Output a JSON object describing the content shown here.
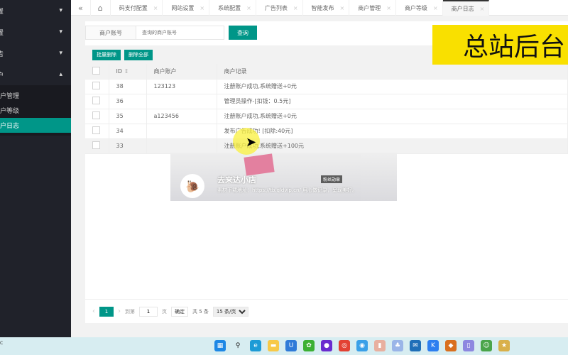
{
  "sidebar": {
    "items": [
      {
        "label": "置"
      },
      {
        "label": "置"
      },
      {
        "label": "告"
      },
      {
        "label": "户"
      }
    ],
    "subitems": [
      {
        "label": "户管理"
      },
      {
        "label": "户等级"
      },
      {
        "label": "户日志",
        "active": true
      }
    ]
  },
  "tabs": [
    {
      "label": "码支付配置"
    },
    {
      "label": "网站设置"
    },
    {
      "label": "系统配置"
    },
    {
      "label": "广告列表"
    },
    {
      "label": "智能发布"
    },
    {
      "label": "商户管理"
    },
    {
      "label": "商户等级"
    },
    {
      "label": "商户日志",
      "active": true
    }
  ],
  "search": {
    "label": "商户账号",
    "placeholder": "查询的商户账号",
    "button": "查询"
  },
  "toolbar": {
    "batch_delete": "批量删除",
    "delete_all": "删除全部"
  },
  "table": {
    "headers": [
      "ID",
      "商户账户",
      "商户记录"
    ],
    "rows": [
      {
        "id": "38",
        "account": "123123",
        "record": "注册账户成功,系统赠送+0元"
      },
      {
        "id": "36",
        "account": "",
        "record": "管理员操作-[扣钱：0.5元]"
      },
      {
        "id": "35",
        "account": "a123456",
        "record": "注册账户成功,系统赠送+0元"
      },
      {
        "id": "34",
        "account": "",
        "record": "发布广告成功! [扣除:40元]"
      },
      {
        "id": "33",
        "account": "",
        "record": "注册账户成功,系统赠送+100元"
      }
    ]
  },
  "pager": {
    "current": "1",
    "goto": "到第",
    "page_value": "1",
    "page_unit": "页",
    "confirm": "确定",
    "total": "共 5 条",
    "per_page": "15 条/页"
  },
  "overlay": {
    "title": "总站后台"
  },
  "banner": {
    "name": "去来达小店",
    "tag": "粉丝勋章",
    "desc": "素材下载地址：https://tb.qldvip.cn/   用心做记录，呈现美好。"
  },
  "taskbar": {
    "clock": "C"
  },
  "colors": {
    "accent": "#009688",
    "sidebar": "#20222a",
    "overlay": "#f9e000"
  }
}
